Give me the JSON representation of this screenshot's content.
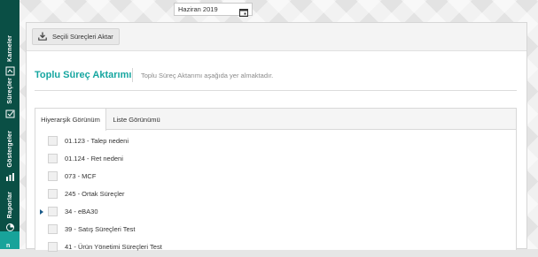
{
  "sidebar": {
    "items": [
      {
        "label": "Karneler",
        "icon": "scorecard-icon"
      },
      {
        "label": "Süreçler",
        "icon": "process-icon"
      },
      {
        "label": "Göstergeler",
        "icon": "indicator-icon"
      },
      {
        "label": "Raporlar",
        "icon": "report-icon"
      }
    ],
    "active_label": "n"
  },
  "date_picker": {
    "value": "Haziran 2019",
    "icon": "calendar-icon"
  },
  "toolbar": {
    "export_label": "Seçili Süreçleri Aktar",
    "export_icon": "download-icon"
  },
  "page": {
    "title": "Toplu Süreç Aktarımı",
    "subtitle": "Toplu Süreç Aktarımı aşağıda yer almaktadır."
  },
  "tabs": [
    {
      "label": "Hiyerarşik Görünüm",
      "active": true
    },
    {
      "label": "Liste Görünümü",
      "active": false
    }
  ],
  "tree_rows": [
    {
      "label": "01.123 - Talep nedeni",
      "expandable": false
    },
    {
      "label": "01.124 - Ret nedeni",
      "expandable": false
    },
    {
      "label": "073 - MCF",
      "expandable": false
    },
    {
      "label": "245 - Ortak Süreçler",
      "expandable": false
    },
    {
      "label": "34 - eBA30",
      "expandable": true
    },
    {
      "label": "39 - Satış Süreçleri Test",
      "expandable": false
    },
    {
      "label": "41 - Ürün Yönetimi Süreçleri Test",
      "expandable": false
    }
  ],
  "colors": {
    "accent": "#16a6a0",
    "sidebar": "#0a4f45",
    "sidebar_active": "#18a39a"
  }
}
